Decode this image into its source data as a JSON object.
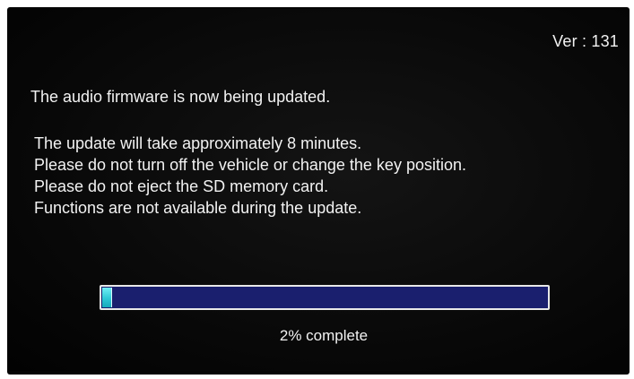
{
  "version_label": "Ver : 131",
  "heading": "The audio firmware is now being updated.",
  "messages": [
    "The update will take approximately 8 minutes.",
    "Please do not turn off the vehicle or change the key position.",
    "Please do not eject the SD memory card.",
    "Functions are not available during the update."
  ],
  "progress": {
    "percent": 2,
    "label": "2% complete"
  },
  "colors": {
    "screen_background": "#070707",
    "text": "#f2f2f2",
    "progress_track": "#1a1f6e",
    "progress_fill": "#2ec8d6",
    "progress_border": "#e8e8e8"
  }
}
